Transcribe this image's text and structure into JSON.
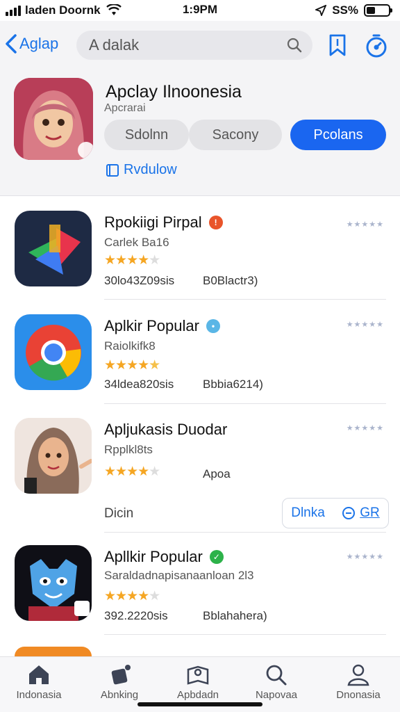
{
  "status_bar": {
    "carrier": "laden Doornk",
    "time": "1:9PM",
    "battery": "SS%"
  },
  "nav": {
    "back_label": "Aglap",
    "search_value": "A dalak"
  },
  "hero": {
    "title": "Apclay Ilnoonesia",
    "subtitle": "Apcrarai",
    "chips": [
      "Sdolnn",
      "Sacony",
      "Pcolans"
    ],
    "link": "Rvdulow"
  },
  "apps": [
    {
      "name": "Rpokiigi Pirpal",
      "sub": "Carlek Ba16",
      "rating": 4,
      "meta1": "30lo43Z09sis",
      "meta2": "B0Blactr3)",
      "badge_color": "#e9542a"
    },
    {
      "name": "Aplkir Popular",
      "sub": "Raiolkifk8",
      "rating": 4.5,
      "meta1": "34ldea820sis",
      "meta2": "Bbbia6214)",
      "badge_color": "#5ab6e6"
    },
    {
      "name": "Apljukasis Duodar",
      "sub": "Rpplkl8ts",
      "rating": 4,
      "meta1": "",
      "meta2": "Apoa",
      "badge_color": ""
    },
    {
      "name": "Apllkir Popular",
      "sub": "Saraldadnapisanaanloan 2l3",
      "rating": 4,
      "meta1": "392.2220sis",
      "meta2": "Bblahahera)",
      "badge_color": "#2db24a"
    }
  ],
  "extra": {
    "left_label": "Dicin",
    "get_label": "Dlnka",
    "get_label2": "GR"
  },
  "tabbar": [
    "Indonasia",
    "Abnking",
    "Apbdadn",
    "Napovaa",
    "Dnonasia"
  ],
  "colors": {
    "accent": "#1a66f0"
  }
}
